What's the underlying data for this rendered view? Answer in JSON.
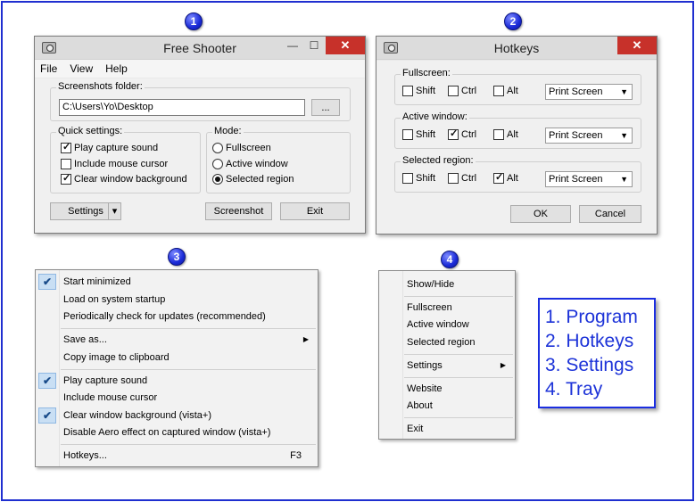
{
  "badges": [
    "1",
    "2",
    "3",
    "4"
  ],
  "program": {
    "title": "Free Shooter",
    "minimize": "—",
    "maximize": "☐",
    "close": "✕",
    "menu": [
      "File",
      "View",
      "Help"
    ],
    "folder_label": "Screenshots folder:",
    "folder_value": "C:\\Users\\Yo\\Desktop",
    "browse": "...",
    "quick_label": "Quick settings:",
    "quick": [
      {
        "label": "Play capture sound",
        "checked": true
      },
      {
        "label": "Include mouse cursor",
        "checked": false
      },
      {
        "label": "Clear window background",
        "checked": true
      }
    ],
    "mode_label": "Mode:",
    "modes": [
      {
        "label": "Fullscreen",
        "selected": false
      },
      {
        "label": "Active window",
        "selected": false
      },
      {
        "label": "Selected region",
        "selected": true
      }
    ],
    "settings_button": "Settings",
    "screenshot_button": "Screenshot",
    "exit_button": "Exit"
  },
  "hotkeys": {
    "title": "Hotkeys",
    "close": "✕",
    "groups": [
      {
        "label": "Fullscreen:",
        "shift": false,
        "ctrl": false,
        "alt": false,
        "key": "Print Screen"
      },
      {
        "label": "Active window:",
        "shift": false,
        "ctrl": true,
        "alt": false,
        "key": "Print Screen"
      },
      {
        "label": "Selected region:",
        "shift": false,
        "ctrl": false,
        "alt": true,
        "key": "Print Screen"
      }
    ],
    "shift_label": "Shift",
    "ctrl_label": "Ctrl",
    "alt_label": "Alt",
    "ok": "OK",
    "cancel": "Cancel"
  },
  "settings_menu": {
    "items": [
      {
        "label": "Start minimized",
        "checked": true
      },
      {
        "label": "Load on system startup",
        "checked": false
      },
      {
        "label": "Periodically check for updates (recommended)",
        "checked": false
      },
      {
        "label": "Save as...",
        "checked": false,
        "submenu": true
      },
      {
        "label": "Copy image to clipboard",
        "checked": false
      },
      {
        "label": "Play capture sound",
        "checked": true
      },
      {
        "label": "Include mouse cursor",
        "checked": false
      },
      {
        "label": "Clear window background (vista+)",
        "checked": true
      },
      {
        "label": "Disable Aero effect on captured window (vista+)",
        "checked": false
      },
      {
        "label": "Hotkeys...",
        "checked": false,
        "shortcut": "F3"
      }
    ]
  },
  "tray_menu": {
    "items": [
      {
        "label": "Show/Hide"
      },
      {
        "label": "Fullscreen"
      },
      {
        "label": "Active window"
      },
      {
        "label": "Selected region"
      },
      {
        "label": "Settings",
        "submenu": true
      },
      {
        "label": "Website"
      },
      {
        "label": "About"
      },
      {
        "label": "Exit"
      }
    ]
  },
  "legend": [
    "1. Program",
    "2. Hotkeys",
    "3. Settings",
    "4. Tray"
  ],
  "colors": {
    "accent": "#1d33d8",
    "close": "#c7312a",
    "check_bg": "#c9dff4"
  }
}
